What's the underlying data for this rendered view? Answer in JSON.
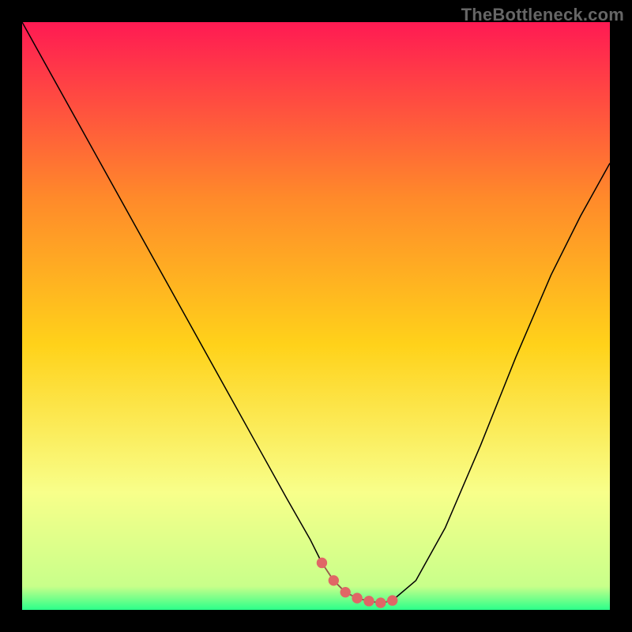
{
  "attribution": "TheBottleneck.com",
  "chart_data": {
    "type": "line",
    "title": "",
    "xlabel": "",
    "ylabel": "",
    "xlim": [
      0,
      100
    ],
    "ylim": [
      0,
      100
    ],
    "background_gradient_stops": [
      {
        "offset": 0,
        "color": "#ff1a53"
      },
      {
        "offset": 30,
        "color": "#ff8a2a"
      },
      {
        "offset": 55,
        "color": "#ffd21a"
      },
      {
        "offset": 80,
        "color": "#f8ff8a"
      },
      {
        "offset": 96,
        "color": "#c8ff8a"
      },
      {
        "offset": 100,
        "color": "#2bff8a"
      }
    ],
    "series": [
      {
        "name": "curve",
        "color": "#000000",
        "width": 1.5,
        "x": [
          0,
          5,
          10,
          15,
          20,
          25,
          30,
          35,
          40,
          45,
          49,
          51,
          53,
          55,
          57,
          59,
          61,
          63,
          67,
          72,
          78,
          84,
          90,
          95,
          100
        ],
        "y": [
          100,
          91,
          82,
          73,
          64,
          55,
          46,
          37,
          28,
          19,
          12,
          8,
          5,
          3,
          2,
          1.5,
          1.2,
          1.6,
          5,
          14,
          28,
          43,
          57,
          67,
          76
        ]
      },
      {
        "name": "trough-highlight",
        "color": "#e06666",
        "width": 7,
        "x": [
          51,
          53,
          55,
          57,
          59,
          61,
          63
        ],
        "y": [
          8,
          5,
          3,
          2,
          1.5,
          1.2,
          1.6
        ]
      }
    ]
  }
}
